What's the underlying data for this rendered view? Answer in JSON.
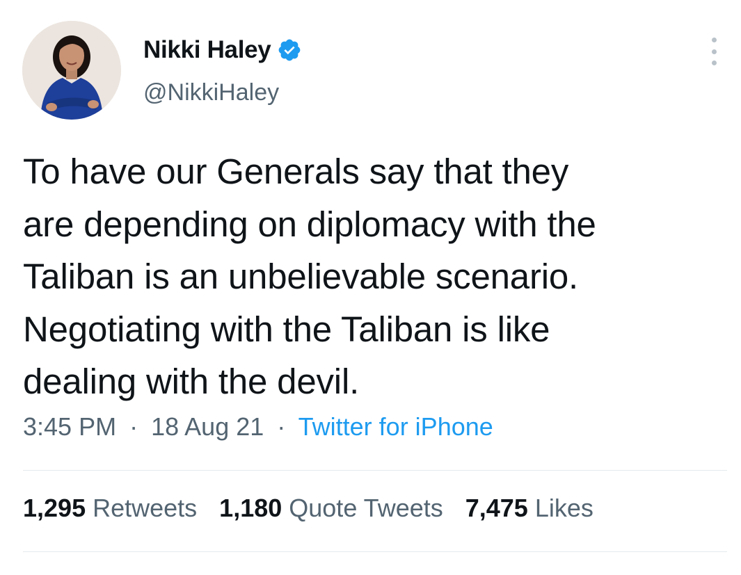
{
  "author": {
    "display_name": "Nikki Haley",
    "handle": "@NikkiHaley",
    "verified": true,
    "avatar_icon": "profile-photo"
  },
  "tweet": {
    "lines": [
      "To have our Generals say that they",
      "are depending on diplomacy with the",
      "Taliban is an unbelievable scenario.",
      "Negotiating with the Taliban is like",
      "dealing with the devil."
    ],
    "time": "3:45 PM",
    "date": "18 Aug 21",
    "separator": "·",
    "source": "Twitter for iPhone"
  },
  "stats": {
    "retweets_count": "1,295",
    "retweets_label": "Retweets",
    "quotes_count": "1,180",
    "quotes_label": "Quote Tweets",
    "likes_count": "7,475",
    "likes_label": "Likes"
  },
  "colors": {
    "text": "#0f1419",
    "secondary": "#536471",
    "accent": "#1d9bf0",
    "divider": "#e6eaed"
  },
  "icons": {
    "verified": "verified-badge-icon",
    "more": "more-options-icon"
  }
}
